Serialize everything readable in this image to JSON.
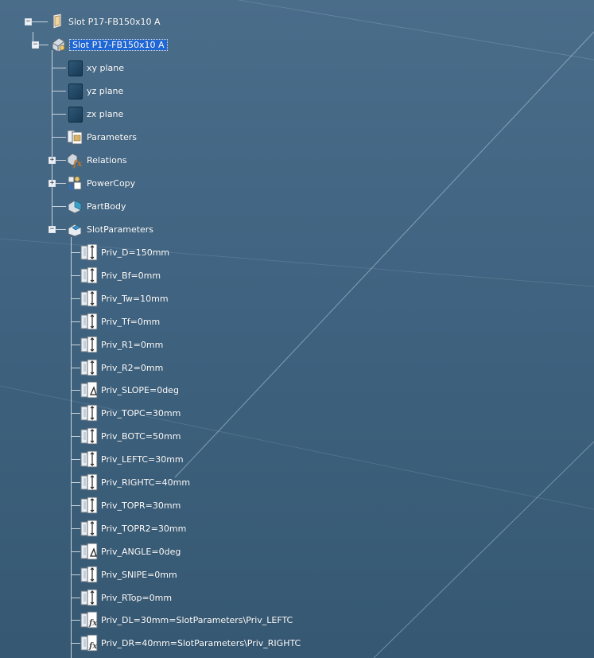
{
  "root": {
    "label": "Slot P17-FB150x10 A",
    "expander": "−"
  },
  "part": {
    "label": "Slot P17-FB150x10 A",
    "expander": "−"
  },
  "children": [
    {
      "label": "xy plane",
      "icon": "plane-icon"
    },
    {
      "label": "yz plane",
      "icon": "plane-icon"
    },
    {
      "label": "zx plane",
      "icon": "plane-icon"
    },
    {
      "label": "Parameters",
      "icon": "parameters-icon"
    },
    {
      "label": "Relations",
      "icon": "relations-icon",
      "expander": "+"
    },
    {
      "label": "PowerCopy",
      "icon": "powercopy-icon",
      "expander": "+"
    },
    {
      "label": "PartBody",
      "icon": "partbody-icon"
    },
    {
      "label": "SlotParameters",
      "icon": "parameter-set-icon",
      "expander": "−"
    }
  ],
  "params": [
    {
      "label": "Priv_D=150mm",
      "icon": "length-parameter-icon"
    },
    {
      "label": "Priv_Bf=0mm",
      "icon": "length-parameter-icon"
    },
    {
      "label": "Priv_Tw=10mm",
      "icon": "length-parameter-icon"
    },
    {
      "label": "Priv_Tf=0mm",
      "icon": "length-parameter-icon"
    },
    {
      "label": "Priv_R1=0mm",
      "icon": "length-parameter-icon"
    },
    {
      "label": "Priv_R2=0mm",
      "icon": "length-parameter-icon"
    },
    {
      "label": "Priv_SLOPE=0deg",
      "icon": "angle-parameter-icon"
    },
    {
      "label": "Priv_TOPC=30mm",
      "icon": "length-parameter-icon"
    },
    {
      "label": "Priv_BOTC=50mm",
      "icon": "length-parameter-icon"
    },
    {
      "label": "Priv_LEFTC=30mm",
      "icon": "length-parameter-icon"
    },
    {
      "label": "Priv_RIGHTC=40mm",
      "icon": "length-parameter-icon"
    },
    {
      "label": "Priv_TOPR=30mm",
      "icon": "length-parameter-icon"
    },
    {
      "label": "Priv_TOPR2=30mm",
      "icon": "length-parameter-icon"
    },
    {
      "label": "Priv_ANGLE=0deg",
      "icon": "angle-parameter-icon"
    },
    {
      "label": "Priv_SNIPE=0mm",
      "icon": "length-parameter-icon"
    },
    {
      "label": "Priv_RTop=0mm",
      "icon": "length-parameter-icon"
    },
    {
      "label": "Priv_DL=30mm=SlotParameters\\Priv_LEFTC",
      "icon": "formula-parameter-icon"
    },
    {
      "label": "Priv_DR=40mm=SlotParameters\\Priv_RIGHTC",
      "icon": "formula-parameter-icon"
    }
  ],
  "colors": {
    "background": "#416684",
    "selection": "#1f67d6",
    "connector": "#c9d3dc"
  }
}
